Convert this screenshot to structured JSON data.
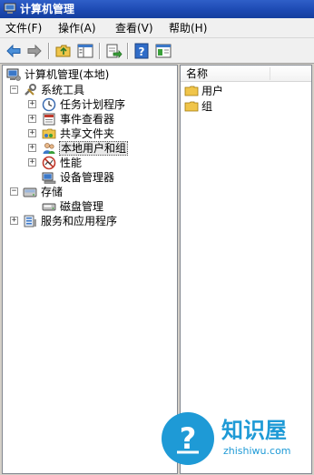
{
  "window": {
    "title": "计算机管理",
    "icon": "computer-management-icon"
  },
  "menubar": {
    "items": [
      "文件(F)",
      "操作(A)",
      "查看(V)",
      "帮助(H)"
    ]
  },
  "toolbar": {
    "buttons": [
      "back-arrow-icon",
      "forward-arrow-icon",
      "up-folder-icon",
      "show-hide-tree-icon",
      "export-list-icon",
      "help-icon",
      "properties-icon"
    ]
  },
  "tree": {
    "root": "计算机管理(本地)",
    "system_tools": "系统工具",
    "task_scheduler": "任务计划程序",
    "event_viewer": "事件查看器",
    "shared_folders": "共享文件夹",
    "local_users_groups": "本地用户和组",
    "performance": "性能",
    "device_manager": "设备管理器",
    "storage": "存储",
    "disk_management": "磁盘管理",
    "services_apps": "服务和应用程序",
    "expander_plus": "+",
    "expander_minus": "−"
  },
  "list": {
    "column_name": "名称",
    "items": [
      "用户",
      "组"
    ]
  },
  "watermark": {
    "brand": "知识屋",
    "domain": "zhishiwu.com"
  },
  "colors": {
    "titlebar": "#1d4ab3",
    "selection": "#e8e8e8",
    "folder": "#f0c54a",
    "watermark": "#1e9ad6"
  }
}
